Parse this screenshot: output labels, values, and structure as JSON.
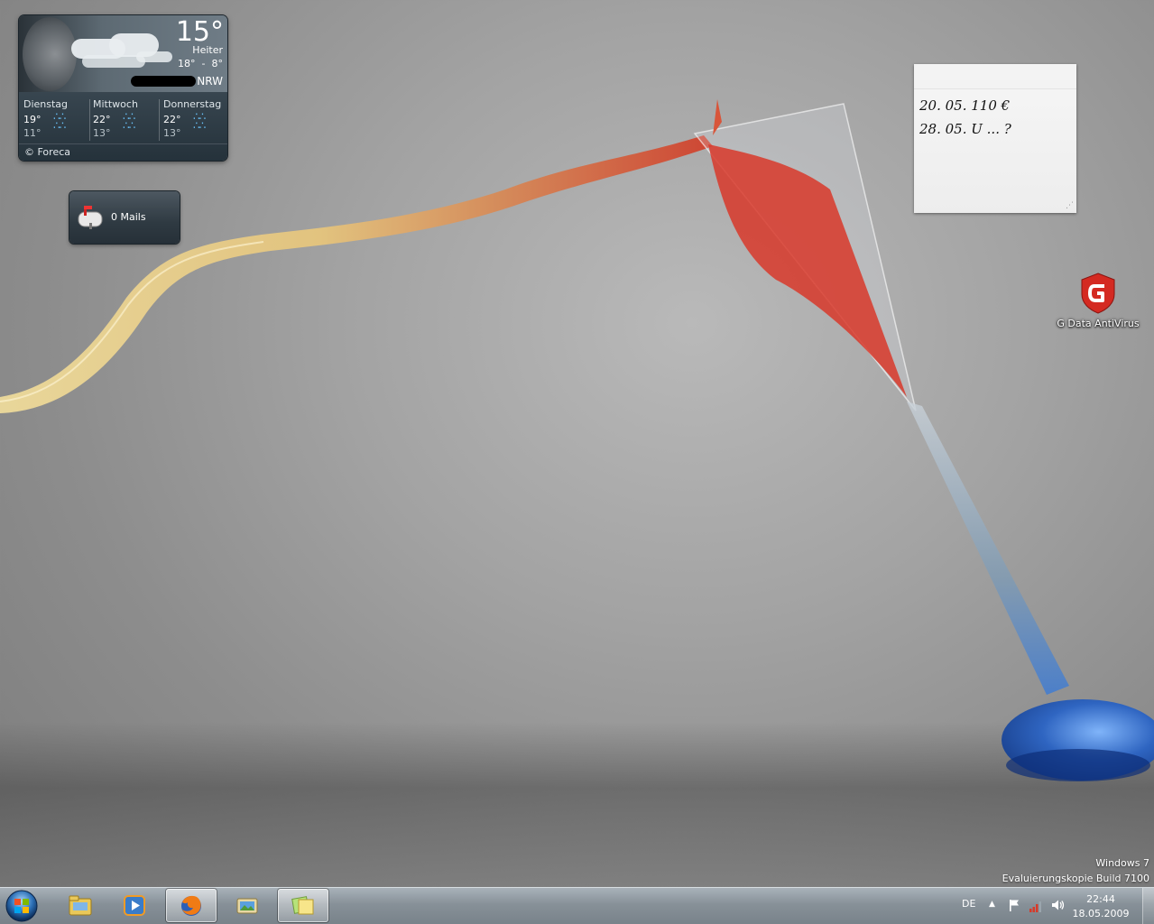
{
  "weather": {
    "temperature": "15°",
    "condition": "Heiter",
    "high": "18°",
    "dash": "-",
    "low": "8°",
    "region": "NRW",
    "forecast": [
      {
        "day": "Dienstag",
        "high": "19°",
        "low": "11°"
      },
      {
        "day": "Mittwoch",
        "high": "22°",
        "low": "13°"
      },
      {
        "day": "Donnerstag",
        "high": "22°",
        "low": "13°"
      }
    ],
    "credit": "© Foreca",
    "rain_glyph": "∴∴"
  },
  "mail": {
    "label": "0 Mails"
  },
  "note": {
    "lines": [
      "20. 05. 110 €",
      "28. 05. U ... ?"
    ]
  },
  "desktop_icons": [
    {
      "label": "G Data AntiVirus",
      "icon": "gdata-shield-icon"
    }
  ],
  "watermark": {
    "line1": "Windows 7",
    "line2": "Evaluierungskopie Build 7100"
  },
  "taskbar": {
    "pinned": [
      {
        "name": "explorer",
        "icon": "folder-icon"
      },
      {
        "name": "media-player",
        "icon": "media-player-icon"
      },
      {
        "name": "firefox",
        "icon": "firefox-icon",
        "active": true
      },
      {
        "name": "slideshow",
        "icon": "slideshow-icon"
      },
      {
        "name": "sticky-notes",
        "icon": "sticky-notes-icon",
        "active": true
      }
    ],
    "tray": {
      "language": "DE",
      "show_hidden": "▲",
      "time": "22:44",
      "date": "18.05.2009"
    }
  },
  "colors": {
    "accent_red": "#d42a22",
    "glass_blue": "#2a63c4",
    "note_bg": "#f2f2f2"
  }
}
